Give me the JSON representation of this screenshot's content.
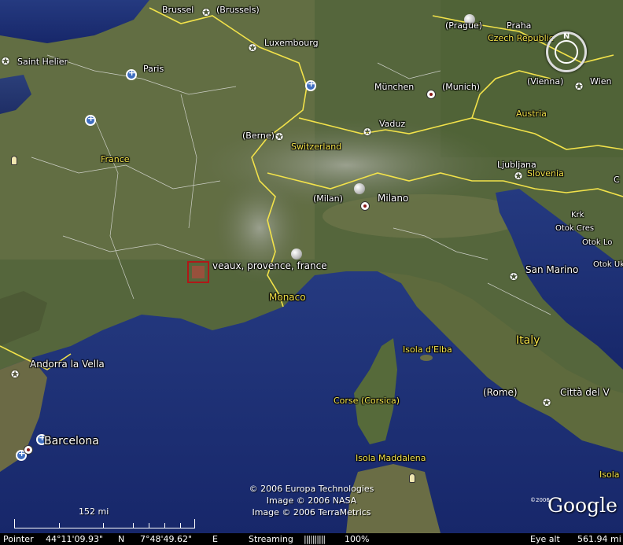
{
  "places": {
    "brussel": "Brussel",
    "brussels": "(Brussels)",
    "luxembourg": "Luxembourg",
    "saint_helier": "Saint Helier",
    "paris": "Paris",
    "prague": "(Prague)",
    "praha": "Praha",
    "czech": "Czech Republic",
    "munchen": "München",
    "munich": "(Munich)",
    "vienna": "(Vienna)",
    "wien": "Wien",
    "vaduz": "Vaduz",
    "austria": "Austria",
    "berne": "(Berne)",
    "switzerland": "Switzerland",
    "france": "France",
    "ljubljana": "Ljubljana",
    "slovenia": "Slovenia",
    "milan": "(Milan)",
    "milano": "Milano",
    "krk": "Krk",
    "otok_cres": "Otok Cres",
    "otok_lo": "Otok Lo",
    "otok_uk": "Otok Uk",
    "search": "veaux, provence, france",
    "monaco": "Monaco",
    "san_marino": "San Marino",
    "isola_elba": "Isola d'Elba",
    "italy": "Italy",
    "andorra": "Andorra la Vella",
    "rome": "(Rome)",
    "citta": "Città del V",
    "corse": "Corse (Corsica)",
    "barcelona": "Barcelona",
    "maddalena": "Isola Maddalena",
    "isola_right": "Isola",
    "ljubljana_c": "C"
  },
  "copyright": {
    "line1": "© 2006 Europa Technologies",
    "line2": "Image © 2006 NASA",
    "line3": "Image © 2006 TerraMetrics"
  },
  "logo": {
    "text": "Google",
    "sup": "©2006"
  },
  "compass": {
    "north": "N"
  },
  "scale": {
    "label": "152 mi"
  },
  "status": {
    "pointer_label": "Pointer",
    "lat": "44°11'09.93\"",
    "lat_dir": "N",
    "lon": "7°48'49.62\"",
    "lon_dir": "E",
    "streaming_label": "Streaming",
    "streaming_bar": "||||||||||",
    "streaming_pct": "100%",
    "eye_label": "Eye alt",
    "eye_value": "561.94 mi"
  },
  "colors": {
    "border": "#f2e24a",
    "sea": "#1a2e6e",
    "marker": "#b01818"
  }
}
